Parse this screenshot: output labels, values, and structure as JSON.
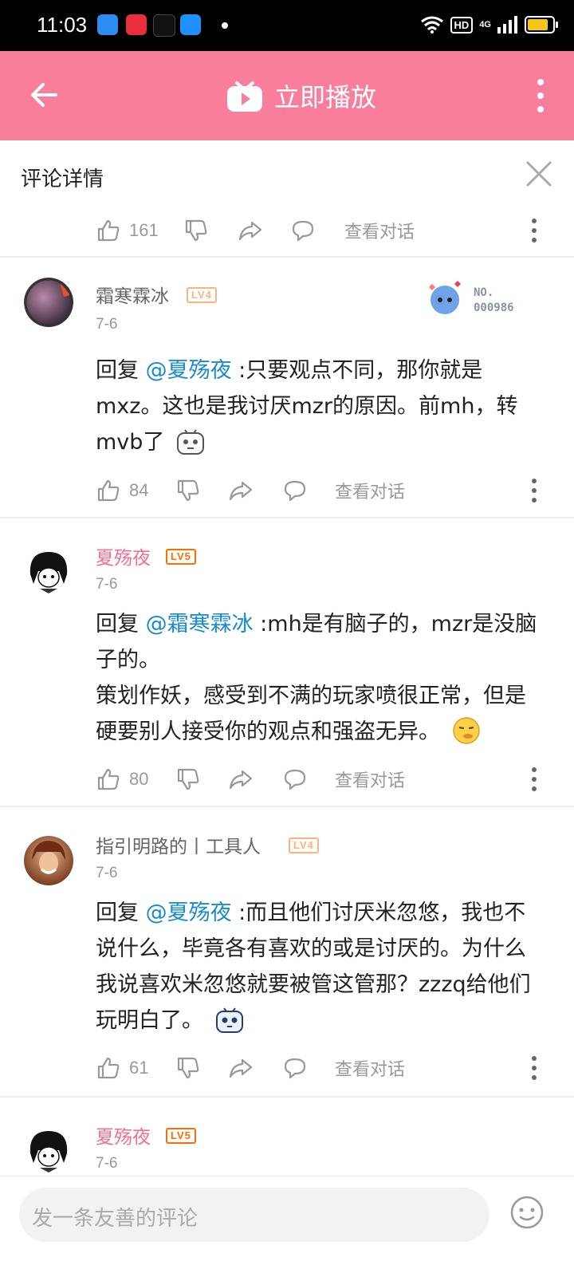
{
  "status_bar": {
    "time": "11:03",
    "hd": "HD",
    "network": "4G"
  },
  "top_bar": {
    "title": "立即播放"
  },
  "sheet": {
    "title": "评论详情"
  },
  "partial_actions": {
    "likes": "161",
    "view_conversation": "查看对话"
  },
  "comments": [
    {
      "username": "霜寒霖冰",
      "level": "LV4",
      "date": "7-6",
      "badge": {
        "line1": "NO.",
        "line2": "000986"
      },
      "reply_prefix": "回复 ",
      "mention": "@夏殇夜",
      "text": " :只要观点不同，那你就是mxz。这也是我讨厌mzr的原因。前mh，转mvb了",
      "likes": "84",
      "view_conversation": "查看对话"
    },
    {
      "username": "夏殇夜",
      "level": "LV5",
      "date": "7-6",
      "reply_prefix": "回复 ",
      "mention": "@霜寒霖冰",
      "text": " :mh是有脑子的，mzr是没脑子的。",
      "text2": "策划作妖，感受到不满的玩家喷很正常，但是硬要别人接受你的观点和强盗无异。",
      "likes": "80",
      "view_conversation": "查看对话"
    },
    {
      "username": "指引明路的丨工具人",
      "level": "LV4",
      "date": "7-6",
      "reply_prefix": "回复 ",
      "mention": "@夏殇夜",
      "text": " :而且他们讨厌米忽悠，我也不说什么，毕竟各有喜欢的或是讨厌的。为什么我说喜欢米忽悠就要被管这管那？zzzq给他们玩明白了。",
      "likes": "61",
      "view_conversation": "查看对话"
    },
    {
      "username": "夏殇夜",
      "level": "LV5",
      "date": "7-6"
    }
  ],
  "bottom_bar": {
    "placeholder": "发一条友善的评论"
  },
  "colors": {
    "accent_pink": "#f87e9c",
    "mention_blue": "#178bcf",
    "vip_name_pink": "#f46d93"
  }
}
